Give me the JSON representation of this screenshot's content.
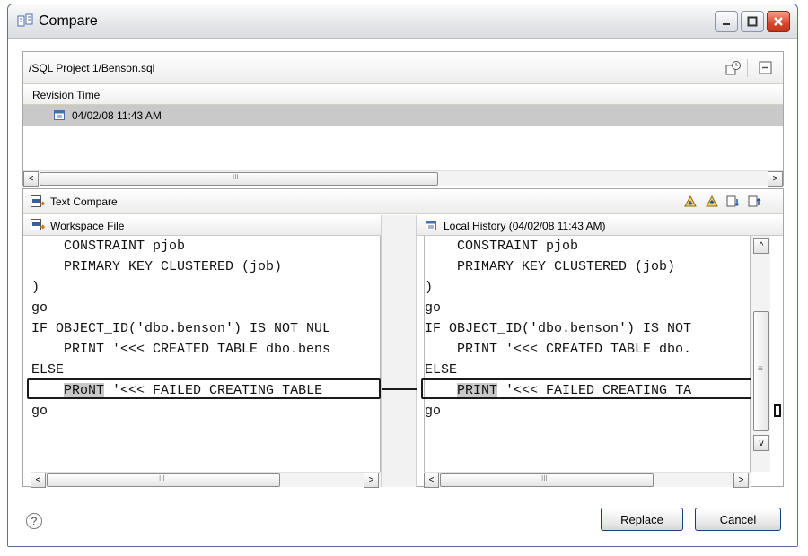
{
  "window": {
    "title": "Compare"
  },
  "history": {
    "path": "/SQL Project 1/Benson.sql",
    "column_header": "Revision Time",
    "selected_revision": "04/02/08 11:43 AM"
  },
  "compare": {
    "title": "Text Compare",
    "left": {
      "title": "Workspace File",
      "lines": [
        "    CONSTRAINT pjob",
        "    PRIMARY KEY CLUSTERED (job)",
        ")",
        "go",
        "IF OBJECT_ID('dbo.benson') IS NOT NUL",
        "    PRINT '<<< CREATED TABLE dbo.bens",
        "ELSE",
        "",
        "go"
      ],
      "diff_indent": "    ",
      "diff_word": "PRoNT",
      "diff_rest": " '<<< FAILED CREATING TABLE"
    },
    "right": {
      "title": "Local History (04/02/08 11:43 AM)",
      "lines": [
        "    CONSTRAINT pjob",
        "    PRIMARY KEY CLUSTERED (job)",
        ")",
        "go",
        "IF OBJECT_ID('dbo.benson') IS NOT",
        "    PRINT '<<< CREATED TABLE dbo.",
        "ELSE",
        "",
        "go"
      ],
      "diff_indent": "    ",
      "diff_word": "PRINT",
      "diff_rest": " '<<< FAILED CREATING TA"
    }
  },
  "buttons": {
    "replace": "Replace",
    "cancel": "Cancel"
  },
  "icons": {
    "help": "?",
    "scroll_left": "<",
    "scroll_right": ">",
    "scroll_up": "^",
    "scroll_down": "v",
    "thumb_grip": "III",
    "vthumb_grip": "≡"
  },
  "colors": {
    "close_button": "#d9442c",
    "selection": "#c9c9c9",
    "button_border": "#1b3d7a"
  }
}
